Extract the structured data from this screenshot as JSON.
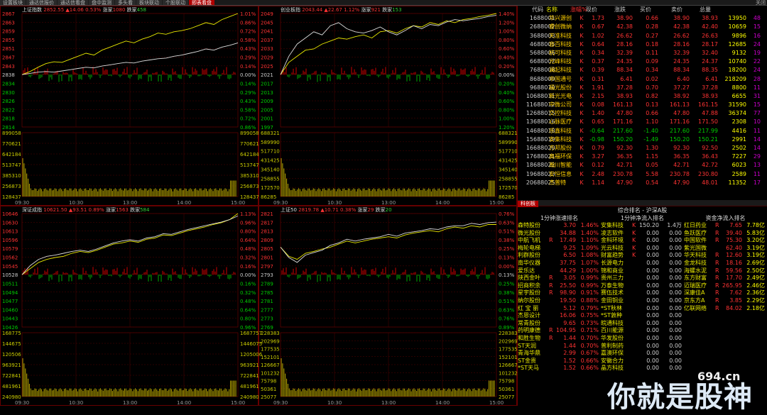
{
  "tabs": [
    "设置板块",
    "通达信报价",
    "通达信看盘",
    "盘中监测",
    "多头看",
    "板块联动",
    "个股联动",
    "即表看盘"
  ],
  "tab_active": 7,
  "corner": "关闭",
  "panels": [
    {
      "name": "上证指数",
      "price": "2852.55",
      "change_pct": "0.53%",
      "change": "▲14.06",
      "up_label": "涨家",
      "up": "1080",
      "down_label": "跌家",
      "down": "458",
      "price_ticks": [
        "2867",
        "2863",
        "2859",
        "2855",
        "2851",
        "2847",
        "2843",
        "2838",
        "2834",
        "2830",
        "2826",
        "2822",
        "2818",
        "2814"
      ],
      "pct_ticks": [
        "1.01%",
        "0.86%",
        "0.72%",
        "0.58%",
        "0.43%",
        "0.29%",
        "0.14%",
        "0.00%",
        "0.14%",
        "0.29%",
        "0.43%",
        "0.58%",
        "0.72%",
        "0.86%"
      ],
      "vol_ticks": [
        "899058",
        "770621",
        "642184",
        "513747",
        "385310",
        "256873",
        "128437"
      ],
      "times": [
        "09:30",
        "10:30",
        "13:00",
        "14:00",
        "15:00"
      ],
      "series": {
        "yellow": [
          0,
          0.05,
          0.12,
          0.18,
          0.21,
          0.2,
          0.25,
          0.3,
          0.35,
          0.32,
          0.4,
          0.45,
          0.5,
          0.55,
          0.52,
          0.58,
          0.62,
          0.68,
          0.66,
          0.7,
          0.72,
          0.75,
          0.8,
          0.85,
          0.82,
          0.9,
          0.95,
          1.0
        ],
        "white": [
          0,
          0.02,
          0.04,
          0.05,
          0.04,
          0.06,
          0.08,
          0.1,
          0.12,
          0.11,
          0.14,
          0.16,
          0.18,
          0.2,
          0.19,
          0.22,
          0.24,
          0.26,
          0.27,
          0.3,
          0.32,
          0.35,
          0.38,
          0.42,
          0.4,
          0.45,
          0.48,
          0.52
        ]
      }
    },
    {
      "name": "创业板指",
      "price": "2043.44",
      "change_pct": "1.12%",
      "change": "▲22.67",
      "up_label": "涨家",
      "up": "921",
      "down_label": "跌家",
      "down": "153",
      "price_ticks": [
        "2049",
        "2045",
        "2041",
        "2037",
        "2033",
        "2029",
        "2025",
        "2021",
        "2017",
        "2013",
        "2009",
        "2005",
        "2001",
        "1997"
      ],
      "pct_ticks": [
        "1.40%",
        "1.20%",
        "1.00%",
        "0.80%",
        "0.60%",
        "0.40%",
        "0.20%",
        "0.00%",
        "0.20%",
        "0.40%",
        "0.60%",
        "0.80%",
        "1.00%",
        "1.20%"
      ],
      "vol_ticks": [
        "688321",
        "589990",
        "517710",
        "431425",
        "345140",
        "258855",
        "172570",
        "86285"
      ],
      "times": [
        "09:30",
        "10:30",
        "13:00",
        "14:00",
        "15:00"
      ],
      "series": {
        "yellow": [
          0,
          0.2,
          0.3,
          0.4,
          0.42,
          0.5,
          0.55,
          0.6,
          0.58,
          0.62,
          0.65,
          0.6,
          0.7,
          0.72,
          0.68,
          0.75,
          0.8,
          0.78,
          0.85,
          0.82,
          0.88,
          0.85,
          0.9,
          0.92,
          0.95,
          0.97,
          1.0
        ],
        "white": [
          0,
          0.3,
          0.5,
          0.6,
          0.7,
          0.65,
          0.8,
          0.85,
          0.75,
          0.7,
          0.68,
          0.72,
          0.78,
          0.7,
          0.65,
          0.72,
          0.8,
          0.75,
          0.82,
          0.8,
          0.86,
          0.9,
          0.88,
          0.9,
          0.92,
          0.95,
          0.97
        ]
      }
    },
    {
      "name": "深证成指",
      "price": "10621.50",
      "change_pct": "0.89%",
      "change": "▲93.51",
      "up_label": "涨家",
      "up": "1563",
      "down_label": "跌家",
      "down": "584",
      "price_ticks": [
        "10646",
        "10630",
        "10613",
        "10596",
        "10579",
        "10562",
        "10545",
        "10528",
        "10511",
        "10494",
        "10477",
        "10460",
        "10443",
        "10426"
      ],
      "pct_ticks": [
        "1.13%",
        "0.96%",
        "0.80%",
        "0.64%",
        "0.48%",
        "0.32%",
        "0.16%",
        "0.00%",
        "0.16%",
        "0.32%",
        "0.48%",
        "0.64%",
        "0.80%",
        "0.96%"
      ],
      "vol_ticks": [
        "1687757",
        "1446075",
        "1205006",
        "963921",
        "722841",
        "481961",
        "240980"
      ],
      "vol_ticks_left": [
        "168775",
        "144675",
        "120506",
        "963921",
        "722841",
        "481961",
        "240980"
      ],
      "times": [
        "09:30",
        "10:30",
        "13:00",
        "14:00",
        "15:00"
      ],
      "series": {
        "yellow": [
          0,
          0.1,
          0.2,
          0.25,
          0.28,
          0.3,
          0.35,
          0.38,
          0.36,
          0.4,
          0.45,
          0.5,
          0.52,
          0.55,
          0.53,
          0.58,
          0.6,
          0.65,
          0.64,
          0.68,
          0.72,
          0.75,
          0.78,
          0.82,
          0.85,
          0.9,
          1.0
        ],
        "white": [
          0,
          0.15,
          0.25,
          0.3,
          0.32,
          0.35,
          0.38,
          0.4,
          0.38,
          0.42,
          0.47,
          0.52,
          0.55,
          0.57,
          0.55,
          0.6,
          0.62,
          0.67,
          0.66,
          0.7,
          0.74,
          0.77,
          0.8,
          0.83,
          0.86,
          0.9,
          0.96
        ]
      }
    },
    {
      "name": "上证50",
      "price": "2819.78",
      "change_pct": "0.38%",
      "change": "▲10.71",
      "up_label": "涨家",
      "up": "29",
      "down_label": "跌家",
      "down": "20",
      "price_ticks": [
        "2821",
        "2817",
        "2813",
        "2809",
        "2805",
        "2801",
        "2797",
        "2793",
        "2789",
        "2785",
        "2781",
        "2777",
        "2773",
        "2769"
      ],
      "pct_ticks": [
        "0.76%",
        "0.63%",
        "0.51%",
        "0.38%",
        "0.25%",
        "0.13%",
        "0.00%",
        "0.13%",
        "0.25%",
        "0.38%",
        "0.51%",
        "0.63%",
        "0.76%",
        "0.89%"
      ],
      "vol_ticks": [
        "228383",
        "202969",
        "177535",
        "152101",
        "126667",
        "101232",
        "75798",
        "50361",
        "25077"
      ],
      "times": [
        "09:30",
        "10:30",
        "13:00",
        "14:00",
        "15:00"
      ],
      "series": {
        "yellow": [
          0.45,
          0.3,
          0.25,
          0.35,
          0.38,
          0.42,
          0.45,
          0.5,
          0.55,
          0.52,
          0.55,
          0.58,
          0.6,
          0.62,
          0.6,
          0.65,
          0.68,
          0.7,
          0.72,
          0.7,
          0.75,
          0.78,
          0.76,
          0.8,
          0.78,
          0.82,
          0.82
        ],
        "white": [
          0.45,
          0.28,
          0.2,
          0.32,
          0.36,
          0.4,
          0.48,
          0.52,
          0.58,
          0.55,
          0.58,
          0.6,
          0.62,
          0.66,
          0.63,
          0.68,
          0.7,
          0.72,
          0.75,
          0.74,
          0.78,
          0.8,
          0.8,
          0.84,
          0.82,
          0.85,
          0.86
        ]
      }
    }
  ],
  "quote_headers": [
    "",
    "代码",
    "名称",
    "",
    "涨幅%",
    "现价",
    "涨跌",
    "买价",
    "卖价",
    "总量",
    ""
  ],
  "quotes": [
    [
      "1",
      "688001",
      "华兴源创",
      "K",
      "1.73",
      "38.90",
      "0.66",
      "38.90",
      "38.93",
      "13950",
      "48"
    ],
    [
      "2",
      "688002",
      "睿创微纳",
      "K",
      "0.67",
      "42.38",
      "0.28",
      "42.38",
      "42.40",
      "10659",
      "15"
    ],
    [
      "3",
      "688003",
      "天准科技",
      "K",
      "1.02",
      "26.62",
      "0.27",
      "26.62",
      "26.63",
      "9896",
      "16"
    ],
    [
      "4",
      "688005",
      "容百科技",
      "K",
      "0.64",
      "28.16",
      "0.18",
      "28.16",
      "28.17",
      "12685",
      "24"
    ],
    [
      "5",
      "688006",
      "杭可科技",
      "K",
      "0.34",
      "32.39",
      "0.11",
      "32.39",
      "32.40",
      "9132",
      "19"
    ],
    [
      "6",
      "688007",
      "光峰科技",
      "K",
      "0.37",
      "24.35",
      "0.09",
      "24.35",
      "24.37",
      "10740",
      "22"
    ],
    [
      "7",
      "688008",
      "澜起科技",
      "K",
      "0.39",
      "88.34",
      "0.34",
      "88.34",
      "88.35",
      "18200",
      "24"
    ],
    [
      "8",
      "688009",
      "中国通号",
      "K",
      "0.31",
      "6.41",
      "0.02",
      "6.40",
      "6.41",
      "218209",
      "28"
    ],
    [
      "9",
      "688010",
      "福光股份",
      "K",
      "1.91",
      "37.28",
      "0.70",
      "37.27",
      "37.28",
      "8800",
      "11"
    ],
    [
      "10",
      "688011",
      "新光光电",
      "K",
      "2.15",
      "38.93",
      "0.82",
      "38.92",
      "38.93",
      "6655",
      "31"
    ],
    [
      "11",
      "688012",
      "中微公司",
      "K",
      "0.08",
      "161.13",
      "0.13",
      "161.13",
      "161.15",
      "31590",
      "15"
    ],
    [
      "12",
      "688015",
      "交控科技",
      "K",
      "1.40",
      "47.80",
      "0.66",
      "47.80",
      "47.88",
      "36374",
      "77"
    ],
    [
      "13",
      "688016",
      "心脉医疗",
      "K",
      "0.65",
      "171.16",
      "1.10",
      "171.16",
      "171.50",
      "2308",
      "10"
    ],
    [
      "14",
      "688018",
      "乐鑫科技",
      "K",
      "-0.64",
      "217.60",
      "-1.40",
      "217.60",
      "217.99",
      "4416",
      "11"
    ],
    [
      "15",
      "688019",
      "安集科技",
      "K",
      "-0.98",
      "150.20",
      "-1.49",
      "150.20",
      "150.21",
      "2991",
      "14"
    ],
    [
      "16",
      "688020",
      "方邦股份",
      "K",
      "0.79",
      "92.30",
      "1.30",
      "92.30",
      "92.50",
      "2502",
      "14"
    ],
    [
      "17",
      "688021",
      "奥福环保",
      "K",
      "3.27",
      "36.35",
      "1.15",
      "36.35",
      "36.43",
      "7227",
      "29"
    ],
    [
      "18",
      "688022",
      "瀚川智能",
      "K",
      "0.12",
      "42.71",
      "0.05",
      "42.71",
      "42.72",
      "6023",
      "13"
    ],
    [
      "19",
      "688023",
      "安恒信息",
      "K",
      "2.48",
      "230.78",
      "5.58",
      "230.78",
      "230.80",
      "2589",
      "11"
    ],
    [
      "20",
      "688025",
      "杰普特",
      "K",
      "1.14",
      "47.90",
      "0.54",
      "47.90",
      "48.01",
      "11352",
      "17"
    ]
  ],
  "ranking": {
    "tab": "科创板",
    "title": "综合排名 - 沪深A股",
    "headers": [
      "1分钟涨速排名",
      "1分钟净流入排名",
      "资金净流入排名"
    ],
    "col1": [
      [
        "森特股份",
        "",
        "3.70",
        "1.46%"
      ],
      [
        "微光股份",
        "",
        "34.88",
        "1.40%"
      ],
      [
        "中航飞机",
        "R",
        "17.49",
        "1.10%"
      ],
      [
        "梅轮电梯",
        "",
        "9.25",
        "1.09%"
      ],
      [
        "利群股份",
        "",
        "6.50",
        "1.08%"
      ],
      [
        "南华仪器",
        "",
        "37.75",
        "1.07%"
      ],
      [
        "爱乐达",
        "",
        "44.29",
        "1.00%"
      ],
      [
        "陕西金叶",
        "R",
        "3.05",
        "0.99%"
      ],
      [
        "招商积余",
        "R",
        "25.50",
        "0.99%"
      ],
      [
        "星宇股份",
        "R",
        "98.90",
        "0.91%"
      ],
      [
        "纳尔股份",
        "",
        "19.50",
        "0.88%"
      ],
      [
        "红 宝 丽",
        "",
        "5.12",
        "0.79%"
      ],
      [
        "杰恩设计",
        "",
        "16.06",
        "0.75%"
      ],
      [
        "常青股份",
        "",
        "9.65",
        "0.73%"
      ],
      [
        "药明康德",
        "R",
        "104.95",
        "0.71%"
      ],
      [
        "和胜生物",
        "R",
        "1.44",
        "0.70%"
      ],
      [
        "ST天润",
        "",
        "1.44",
        "0.70%"
      ],
      [
        "青海华鼎",
        "",
        "2.99",
        "0.67%"
      ],
      [
        "ST金贵",
        "",
        "1.52",
        "0.66%"
      ],
      [
        "*ST天马",
        "",
        "1.52",
        "0.66%"
      ]
    ],
    "col2": [
      [
        "安集科技",
        "K",
        "150.20",
        "1.4万"
      ],
      [
        "凌志软件",
        "K",
        "0.00",
        "0.00"
      ],
      [
        "金科环境",
        "K",
        "0.00",
        "0.00"
      ],
      [
        "光云科技",
        "K",
        "0.00",
        "0.00"
      ],
      [
        "财富趋势",
        "K",
        "0.00",
        "0.00"
      ],
      [
        "长源电力",
        "",
        "0.00",
        "0.00"
      ],
      [
        "锦和商业",
        "",
        "0.00",
        "0.00"
      ],
      [
        "贵州三力",
        "",
        "0.00",
        "0.00"
      ],
      [
        "万泰生物",
        "",
        "0.00",
        "0.00"
      ],
      [
        "赛伍技术",
        "",
        "0.00",
        "0.00"
      ],
      [
        "金田铜业",
        "",
        "0.00",
        "0.00"
      ],
      [
        "*ST秋林",
        "",
        "0.00",
        "0.00"
      ],
      [
        "*ST敦种",
        "",
        "0.00",
        "0.00"
      ],
      [
        "皖通科技",
        "",
        "0.00",
        "0.00"
      ],
      [
        "百川能源",
        "",
        "0.00",
        "0.00"
      ],
      [
        "华发股份",
        "",
        "0.00",
        "0.00"
      ],
      [
        "普利制药",
        "",
        "0.00",
        "0.00"
      ],
      [
        "嘉澳环保",
        "",
        "0.00",
        "0.00"
      ],
      [
        "安徽合力",
        "",
        "0.00",
        "0.00"
      ],
      [
        "晶方科技",
        "",
        "0.00",
        "0.00"
      ]
    ],
    "col3": [
      [
        "红日药业",
        "R",
        "7.65",
        "7.78亿"
      ],
      [
        "鱼跃医疗",
        "R",
        "39.40",
        "5.83亿"
      ],
      [
        "中国软件",
        "R",
        "75.30",
        "3.20亿"
      ],
      [
        "紫光国微",
        "",
        "62.40",
        "3.19亿"
      ],
      [
        "华天科技",
        "R",
        "12.60",
        "3.19亿"
      ],
      [
        "金龙科技",
        "R",
        "18.16",
        "2.69亿"
      ],
      [
        "海螺水泥",
        "R",
        "59.56",
        "2.50亿"
      ],
      [
        "东方财富",
        "R",
        "17.70",
        "2.49亿"
      ],
      [
        "迈瑞医疗",
        "R",
        "265.95",
        "2.46亿"
      ],
      [
        "深康佳A",
        "R",
        "7.62",
        "2.36亿"
      ],
      [
        "京东方A",
        "R",
        "3.85",
        "2.29亿"
      ],
      [
        "亿联网络",
        "R",
        "84.02",
        "2.18亿"
      ],
      [
        "",
        "",
        "",
        ""
      ],
      [
        "",
        "",
        "",
        ""
      ],
      [
        "",
        "",
        "",
        ""
      ],
      [
        "",
        "",
        "",
        ""
      ],
      [
        "",
        "",
        "",
        ""
      ],
      [
        "",
        "",
        "",
        ""
      ],
      [
        "",
        "",
        "",
        ""
      ],
      [
        "",
        "",
        "",
        ""
      ]
    ]
  },
  "watermark_url": "694.cn",
  "watermark_text": "你就是股神"
}
